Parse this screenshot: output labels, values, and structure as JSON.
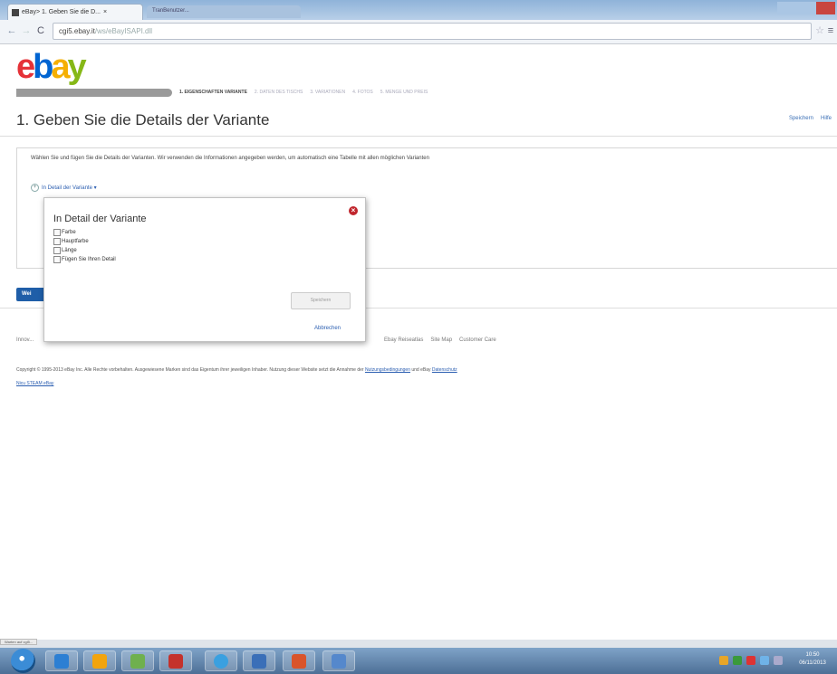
{
  "browser": {
    "tab_title": "eBay> 1. Geben Sie die D...",
    "tab_close": "×",
    "tab2_title": "TranBenutzer...",
    "address_protocol": "",
    "address_host": "cgi5.ebay.it",
    "address_path": "/ws/eBayISAPI.dll"
  },
  "page": {
    "steps": [
      "1. EIGENSCHAFTEN VARIANTE",
      "2. DATEN DES TISCHS",
      "3. VARIATIONEN",
      "4. FOTOS",
      "5. MENGE UND PREIS"
    ],
    "title": "1. Geben Sie die Details der Variante",
    "top_links": [
      "Speichern",
      "Hilfe"
    ],
    "intro": "Wählen Sie und fügen Sie die Details der Varianten. Wir verwenden die Informationen angegeben werden, um automatisch eine Tabelle mit allen möglichen Varianten",
    "detail_link": "In Detail der Variante ▾",
    "weiter_label": "Wei"
  },
  "popup": {
    "title": "In Detail der Variante",
    "options": [
      "Farbe",
      "Hauptfarbe",
      "Länge",
      "Fügen Sie Ihren Detail"
    ],
    "save_label": "Speichern",
    "cancel_label": "Abbrechen"
  },
  "footer": {
    "first": "Innov...",
    "links": [
      "Ebay Reiseatlas",
      "Site Map",
      "Customer Care"
    ],
    "copyright": "Copyright © 1995-2013 eBay Inc. Alle Rechte vorbehalten. Ausgewiesene Marken sind das Eigentum ihrer jeweiligen Inhaber. Nutzung dieser Website setzt die Annahme der",
    "copyright_link1": "Nutzungsbedingungen",
    "copyright_mid": " und eBay ",
    "copyright_link2": "Datenschutz",
    "vertrag": "Nicu STEAM eBay"
  },
  "status_text": "Warten auf cgi5...",
  "clock": {
    "time": "10:50",
    "date": "06/11/2013"
  },
  "taskbar_icon_colors": [
    "#2c7fd3",
    "#f2a40e",
    "#6fb04e",
    "#c4322c",
    "#3aa0e0",
    "#3a6fb8",
    "#d9542b",
    "#5588cc"
  ],
  "tray_icon_colors": [
    "#e7a629",
    "#3a9a3a",
    "#d33",
    "#6fb3e8",
    "#aac"
  ]
}
